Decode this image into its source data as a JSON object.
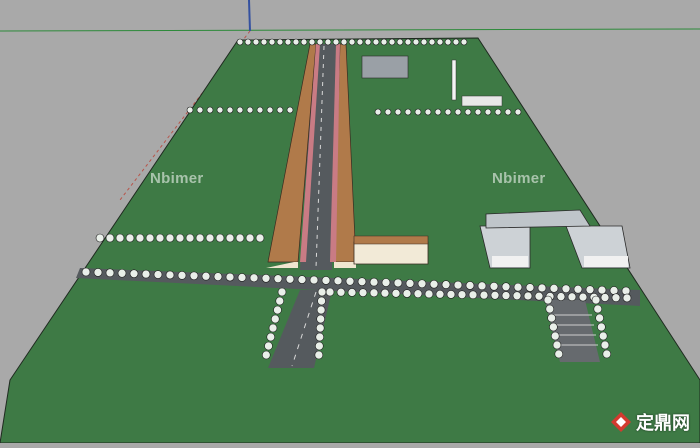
{
  "scene": {
    "background": "#a9a9a9",
    "ground": "#3e7a45",
    "road": "#555a5e",
    "building_roof": "#b07a4a",
    "building_wall": "#f0e6d0",
    "tree": "#e9efe9"
  },
  "watermarks": {
    "left": "Nbimer",
    "right": "Nbimer"
  },
  "brand": {
    "logo_icon": "zhulong-logo",
    "logo_color": "#d33a2f",
    "text": "定鼎网"
  }
}
